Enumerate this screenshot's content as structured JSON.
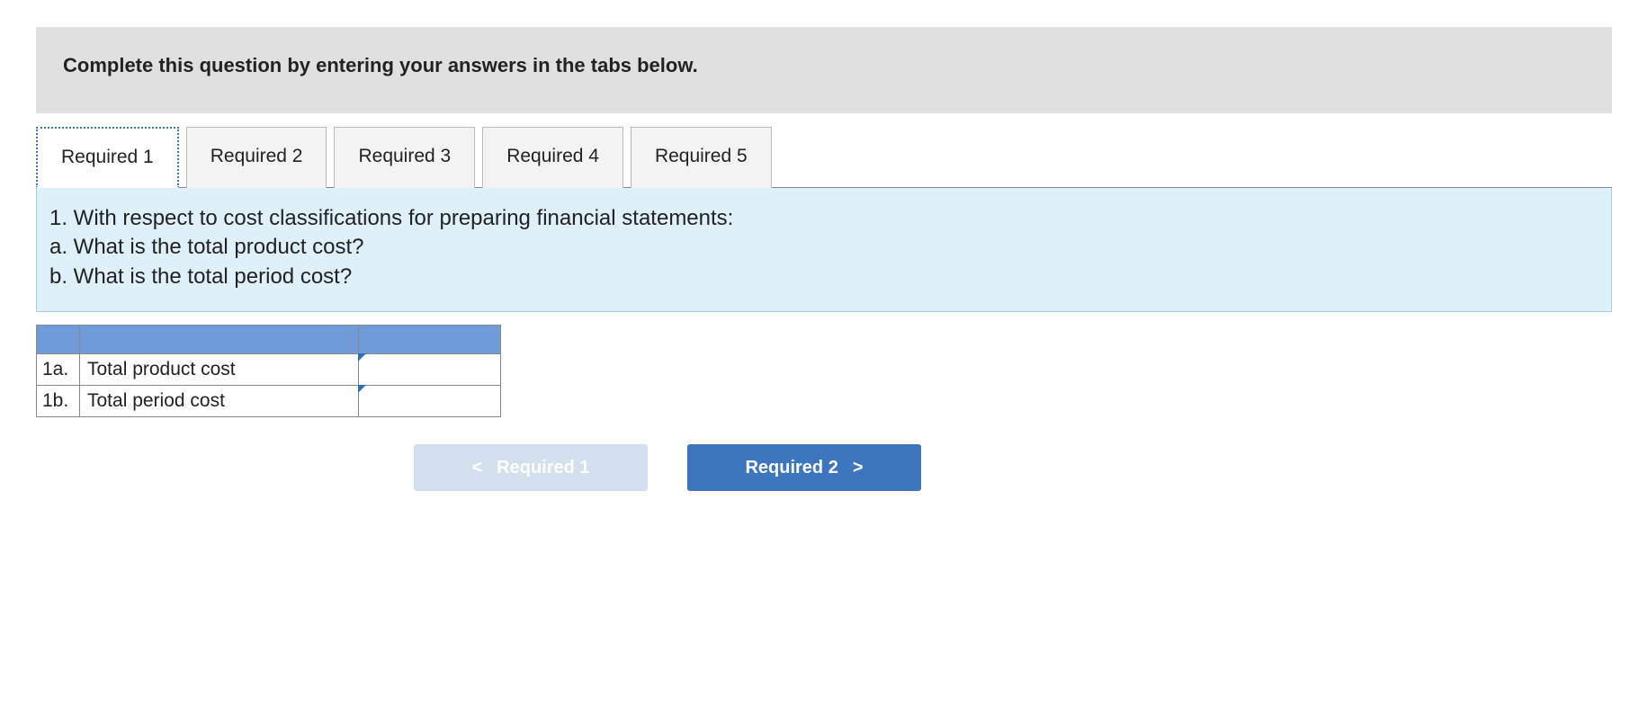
{
  "banner": {
    "text": "Complete this question by entering your answers in the tabs below."
  },
  "tabs": [
    {
      "label": "Required 1",
      "active": true
    },
    {
      "label": "Required 2",
      "active": false
    },
    {
      "label": "Required 3",
      "active": false
    },
    {
      "label": "Required 4",
      "active": false
    },
    {
      "label": "Required 5",
      "active": false
    }
  ],
  "question": {
    "line1": "1. With respect to cost classifications for preparing financial statements:",
    "line2": "a. What is the total product cost?",
    "line3": "b. What is the total period cost?"
  },
  "table": {
    "rows": [
      {
        "idx": "1a.",
        "label": "Total product cost",
        "value": ""
      },
      {
        "idx": "1b.",
        "label": "Total period cost",
        "value": ""
      }
    ]
  },
  "nav": {
    "prev": {
      "label": "Required 1",
      "chev": "<"
    },
    "next": {
      "label": "Required 2",
      "chev": ">"
    }
  }
}
